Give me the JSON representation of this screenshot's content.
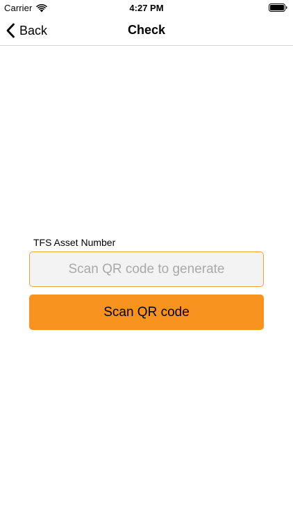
{
  "status_bar": {
    "carrier": "Carrier",
    "time": "4:27 PM",
    "icons": [
      "wifi-icon",
      "battery-icon"
    ]
  },
  "nav_bar": {
    "back_label": "Back",
    "title": "Check",
    "icons": [
      "chevron-left-icon"
    ]
  },
  "form": {
    "field_label": "TFS Asset Number",
    "asset_input": {
      "value": "",
      "placeholder": "Scan QR code to generate"
    },
    "scan_button_label": "Scan QR code"
  },
  "colors": {
    "accent": "#f7931e",
    "input_border": "#f2a43a",
    "input_background": "#f3f3f3",
    "placeholder": "#a9a9a9",
    "divider": "#d8d8d8"
  }
}
